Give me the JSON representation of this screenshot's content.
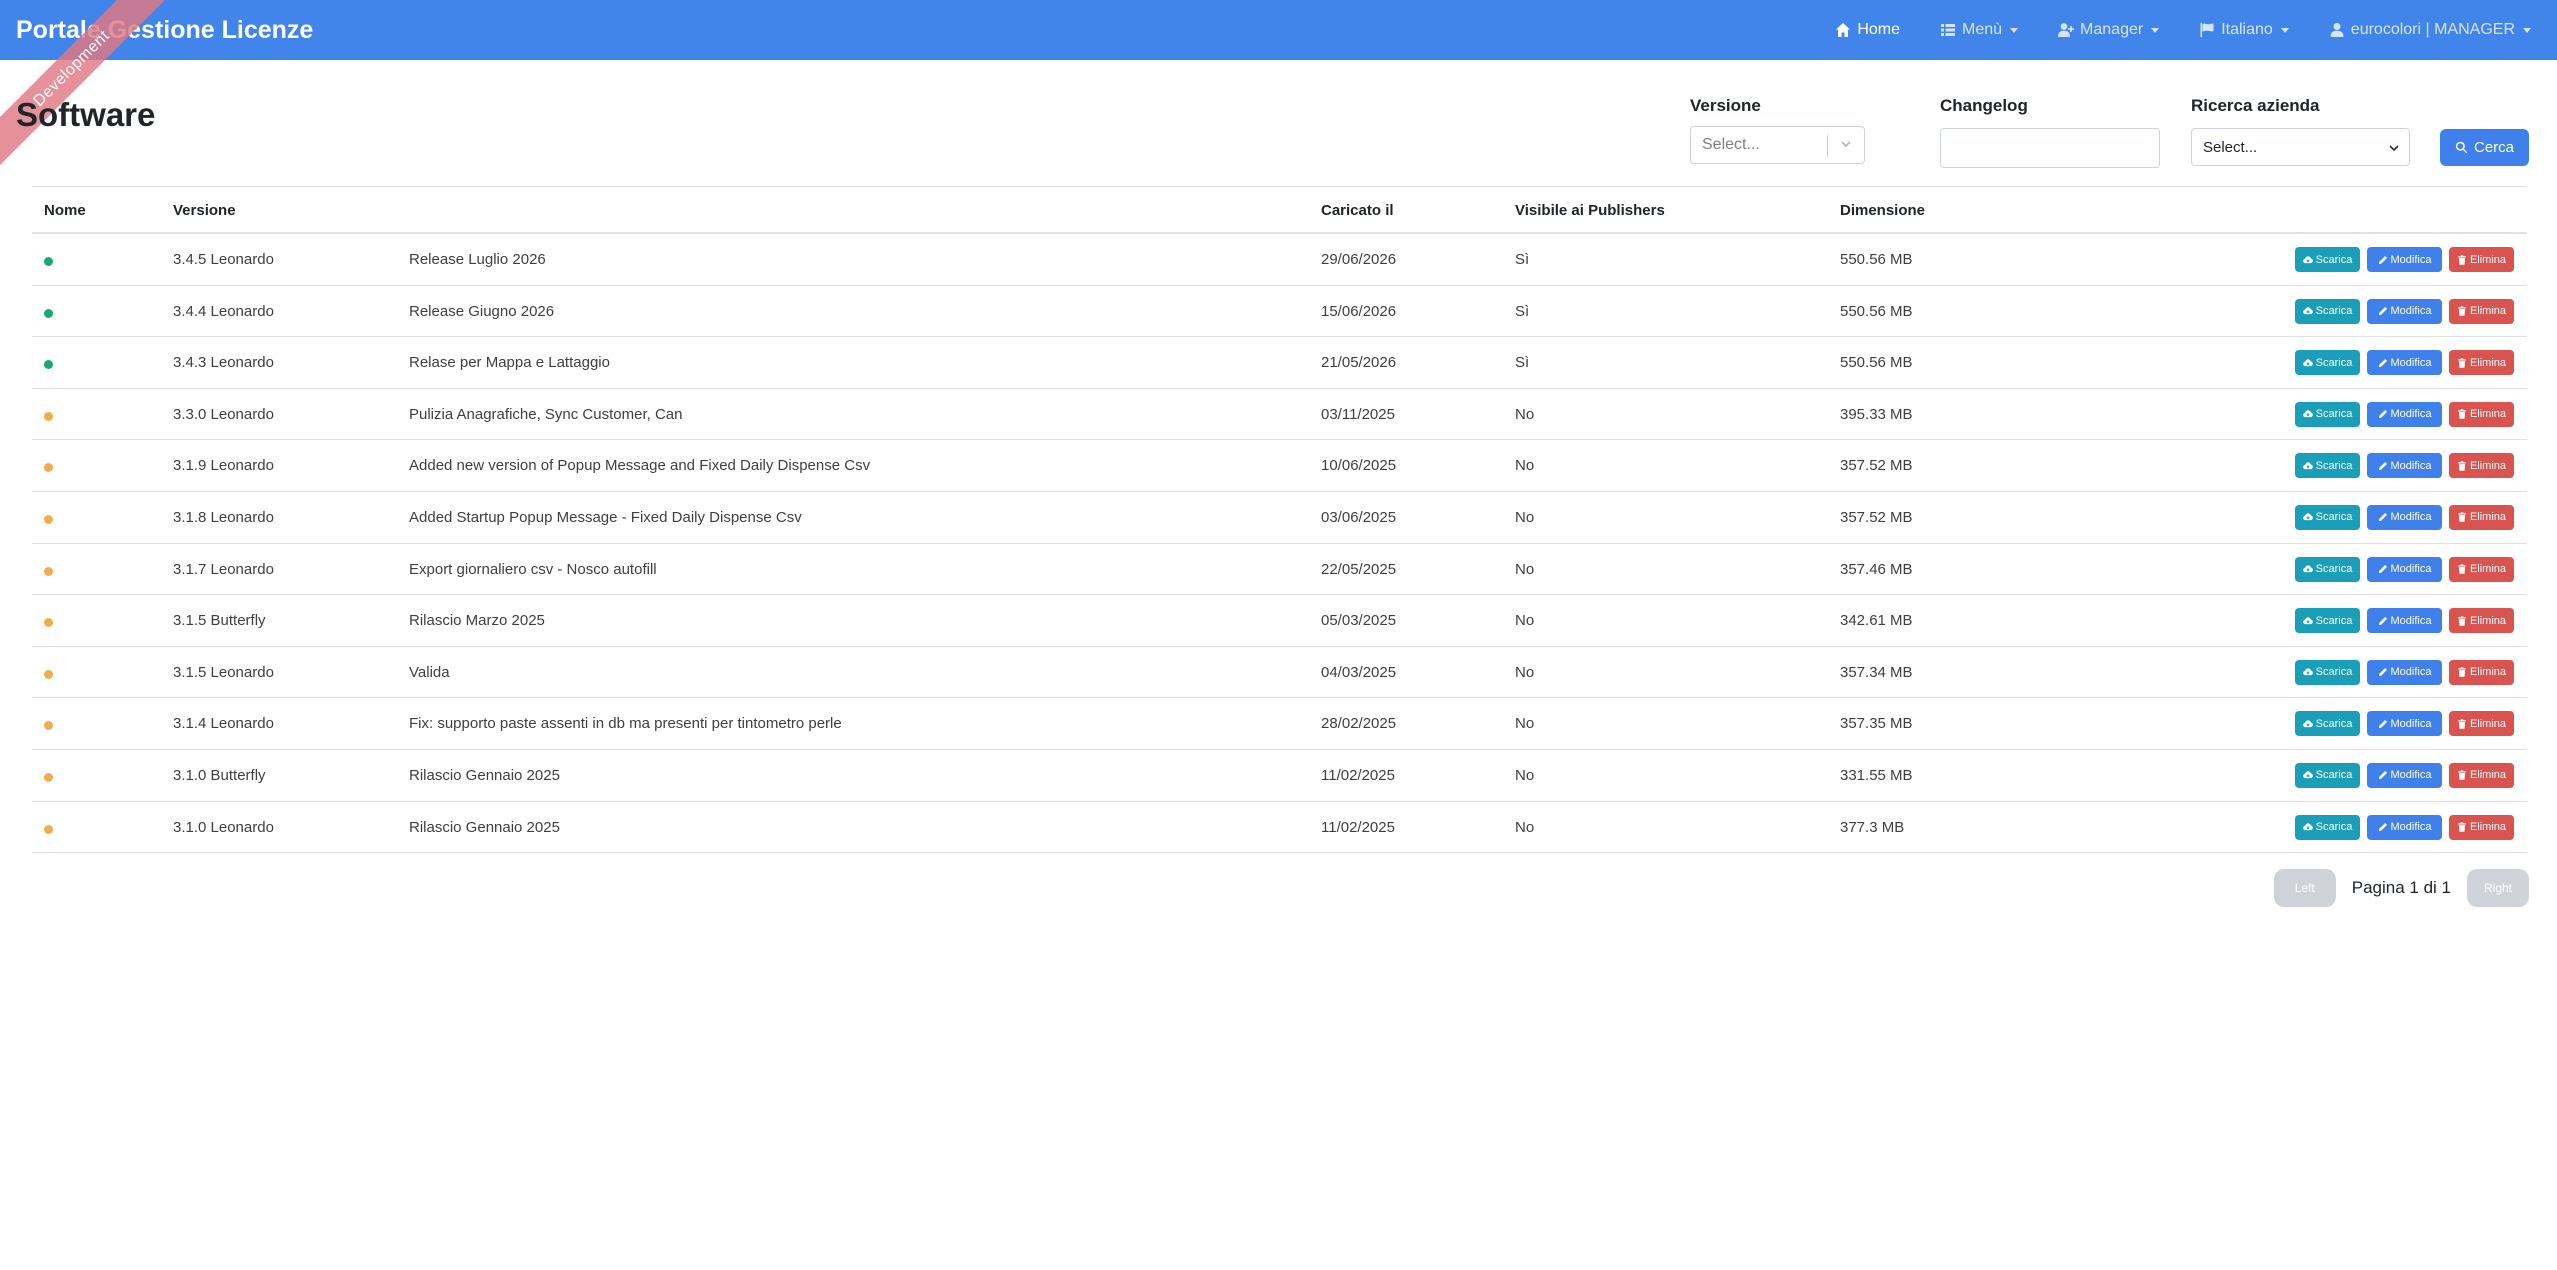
{
  "navbar": {
    "brand": "Portale Gestione Licenze",
    "items": [
      {
        "label": "Home",
        "icon": "home-icon",
        "active": true,
        "dropdown": false
      },
      {
        "label": "Menù",
        "icon": "list-icon",
        "active": false,
        "dropdown": true
      },
      {
        "label": "Manager",
        "icon": "user-plus-icon",
        "active": false,
        "dropdown": true
      },
      {
        "label": "Italiano",
        "icon": "flag-icon",
        "active": false,
        "dropdown": true
      },
      {
        "label": "eurocolori | MANAGER",
        "icon": "user-icon",
        "active": false,
        "dropdown": true
      }
    ],
    "color": "#4285ea"
  },
  "ribbon": {
    "text": "Development"
  },
  "page": {
    "title": "Software"
  },
  "filters": {
    "versione": {
      "label": "Versione",
      "placeholder": "Select..."
    },
    "changelog": {
      "label": "Changelog",
      "value": ""
    },
    "azienda": {
      "label": "Ricerca azienda",
      "placeholder": "Select..."
    },
    "search_button": "Cerca"
  },
  "table": {
    "headers": {
      "nome": "Nome",
      "versione": "Versione",
      "caricato": "Caricato il",
      "visibile": "Visibile ai Publishers",
      "dimensione": "Dimensione"
    },
    "actions": {
      "download": "Scarica",
      "edit": "Modifica",
      "delete": "Elimina"
    },
    "status_colors": {
      "published": "#1aaa6e",
      "unpublished": "#f0ad4e"
    },
    "rows": [
      {
        "status": "published",
        "version": "3.4.5 Leonardo",
        "changelog": "Release Luglio 2026",
        "date": "29/06/2026",
        "visible": "Sì",
        "size": "550.56 MB"
      },
      {
        "status": "published",
        "version": "3.4.4 Leonardo",
        "changelog": "Release Giugno 2026",
        "date": "15/06/2026",
        "visible": "Sì",
        "size": "550.56 MB"
      },
      {
        "status": "published",
        "version": "3.4.3 Leonardo",
        "changelog": "Relase per Mappa e Lattaggio",
        "date": "21/05/2026",
        "visible": "Sì",
        "size": "550.56 MB"
      },
      {
        "status": "unpublished",
        "version": "3.3.0 Leonardo",
        "changelog": "Pulizia Anagrafiche, Sync Customer, Can",
        "date": "03/11/2025",
        "visible": "No",
        "size": "395.33 MB"
      },
      {
        "status": "unpublished",
        "version": "3.1.9 Leonardo",
        "changelog": "Added new version of Popup Message and Fixed Daily Dispense Csv",
        "date": "10/06/2025",
        "visible": "No",
        "size": "357.52 MB"
      },
      {
        "status": "unpublished",
        "version": "3.1.8 Leonardo",
        "changelog": "Added Startup Popup Message - Fixed Daily Dispense Csv",
        "date": "03/06/2025",
        "visible": "No",
        "size": "357.52 MB"
      },
      {
        "status": "unpublished",
        "version": "3.1.7 Leonardo",
        "changelog": "Export giornaliero csv - Nosco autofill",
        "date": "22/05/2025",
        "visible": "No",
        "size": "357.46 MB"
      },
      {
        "status": "unpublished",
        "version": "3.1.5 Butterfly",
        "changelog": "Rilascio Marzo 2025",
        "date": "05/03/2025",
        "visible": "No",
        "size": "342.61 MB"
      },
      {
        "status": "unpublished",
        "version": "3.1.5 Leonardo",
        "changelog": "Valida",
        "date": "04/03/2025",
        "visible": "No",
        "size": "357.34 MB"
      },
      {
        "status": "unpublished",
        "version": "3.1.4 Leonardo",
        "changelog": "Fix: supporto paste assenti in db ma presenti per tintometro perle",
        "date": "28/02/2025",
        "visible": "No",
        "size": "357.35 MB"
      },
      {
        "status": "unpublished",
        "version": "3.1.0 Butterfly",
        "changelog": "Rilascio Gennaio 2025",
        "date": "11/02/2025",
        "visible": "No",
        "size": "331.55 MB"
      },
      {
        "status": "unpublished",
        "version": "3.1.0 Leonardo",
        "changelog": "Rilascio Gennaio 2025",
        "date": "11/02/2025",
        "visible": "No",
        "size": "377.3 MB"
      }
    ]
  },
  "pagination": {
    "prev": "Left",
    "next": "Right",
    "label": "Pagina 1 di 1"
  }
}
